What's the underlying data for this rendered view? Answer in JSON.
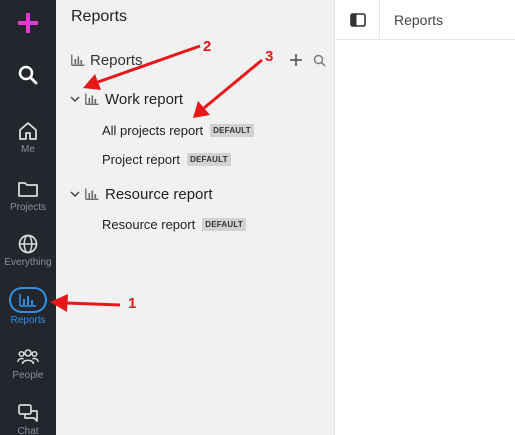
{
  "rail": {
    "me_label": "Me",
    "projects_label": "Projects",
    "everything_label": "Everything",
    "reports_label": "Reports",
    "people_label": "People",
    "chat_label": "Chat",
    "active": "reports",
    "accent": "#2d8fe8",
    "plus_color": "#e835d6"
  },
  "panel": {
    "title": "Reports",
    "section_label": "Reports",
    "groups": [
      {
        "label": "Work report",
        "items": [
          {
            "label": "All projects report",
            "badge": "DEFAULT"
          },
          {
            "label": "Project report",
            "badge": "DEFAULT"
          }
        ]
      },
      {
        "label": "Resource report",
        "items": [
          {
            "label": "Resource report",
            "badge": "DEFAULT"
          }
        ]
      }
    ]
  },
  "main": {
    "title": "Reports"
  },
  "annotations": {
    "one": "1",
    "two": "2",
    "three": "3",
    "color": "#e8171a"
  }
}
